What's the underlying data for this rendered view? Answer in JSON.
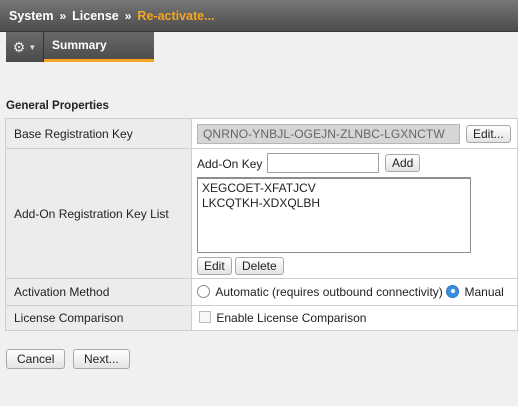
{
  "breadcrumb": {
    "items": [
      "System",
      "License",
      "Re-activate..."
    ],
    "separator": "»"
  },
  "tabs": {
    "gear_icon": "gear-icon",
    "summary_label": "Summary"
  },
  "section": {
    "title": "General Properties"
  },
  "properties": {
    "base_key": {
      "label": "Base Registration Key",
      "value": "QNRNO-YNBJL-OGEJN-ZLNBC-LGXNCTW",
      "edit_label": "Edit..."
    },
    "addon": {
      "label": "Add-On Registration Key List",
      "input_label": "Add-On Key",
      "input_value": "",
      "add_label": "Add",
      "keys": [
        "XEGCOET-XFATJCV",
        "LKCQTKH-XDXQLBH"
      ],
      "edit_label": "Edit",
      "delete_label": "Delete"
    },
    "activation": {
      "label": "Activation Method",
      "option_automatic": "Automatic (requires outbound connectivity)",
      "option_manual": "Manual",
      "selected": "Manual"
    },
    "comparison": {
      "label": "License Comparison",
      "checkbox_label": "Enable License Comparison",
      "checked": false
    }
  },
  "footer": {
    "cancel_label": "Cancel",
    "next_label": "Next..."
  },
  "colors": {
    "accent": "#f5a623",
    "radio_selected": "#3b8fe0"
  }
}
